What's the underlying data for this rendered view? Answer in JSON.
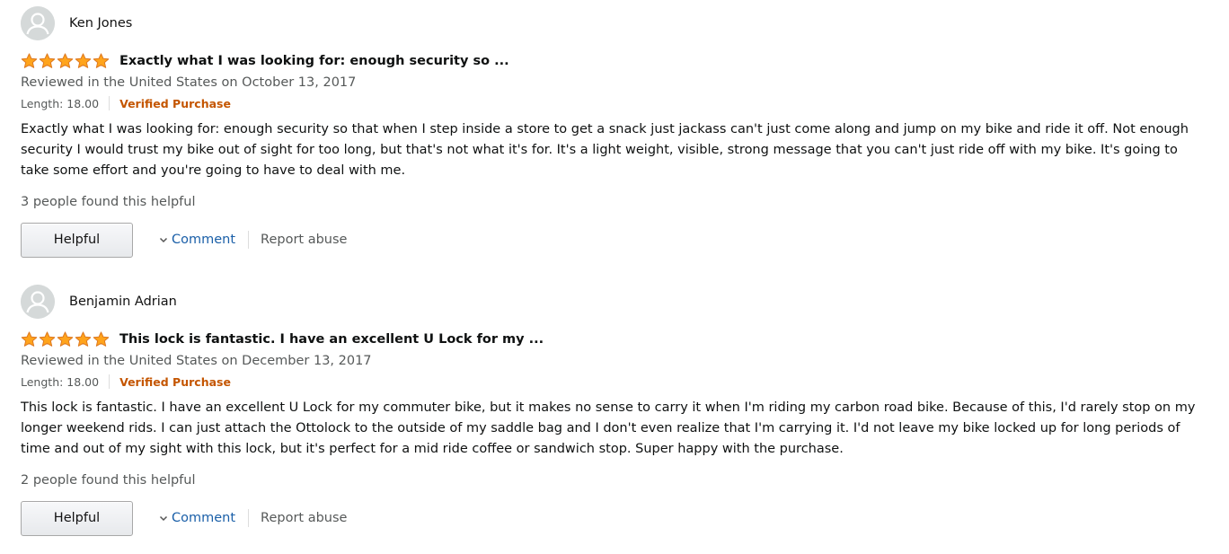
{
  "colors": {
    "star_fill": "#ffa41c",
    "star_stroke": "#de7921",
    "verified": "#c45500",
    "link": "#1a5fa8"
  },
  "reviews": [
    {
      "reviewer": "Ken Jones",
      "rating": 5,
      "title": "Exactly what I was looking for: enough security so ...",
      "date": "Reviewed in the United States on October 13, 2017",
      "variant": "Length: 18.00",
      "verified": "Verified Purchase",
      "body": "Exactly what I was looking for: enough security so that when I step inside a store to get a snack just jackass can't just come along and jump on my bike and ride it off. Not enough security I would trust my bike out of sight for too long, but that's not what it's for. It's a light weight, visible, strong message that you can't just ride off with my bike. It's going to take some effort and you're going to have to deal with me.",
      "helpful_count": "3 people found this helpful",
      "helpful_label": "Helpful",
      "comment_label": "Comment",
      "report_label": "Report abuse"
    },
    {
      "reviewer": "Benjamin Adrian",
      "rating": 5,
      "title": "This lock is fantastic. I have an excellent U Lock for my ...",
      "date": "Reviewed in the United States on December 13, 2017",
      "variant": "Length: 18.00",
      "verified": "Verified Purchase",
      "body": "This lock is fantastic. I have an excellent U Lock for my commuter bike, but it makes no sense to carry it when I'm riding my carbon road bike. Because of this, I'd rarely stop on my longer weekend rids. I can just attach the Ottolock to the outside of my saddle bag and I don't even realize that I'm carrying it. I'd not leave my bike locked up for long periods of time and out of my sight with this lock, but it's perfect for a mid ride coffee or sandwich stop. Super happy with the purchase.",
      "helpful_count": "2 people found this helpful",
      "helpful_label": "Helpful",
      "comment_label": "Comment",
      "report_label": "Report abuse"
    }
  ]
}
